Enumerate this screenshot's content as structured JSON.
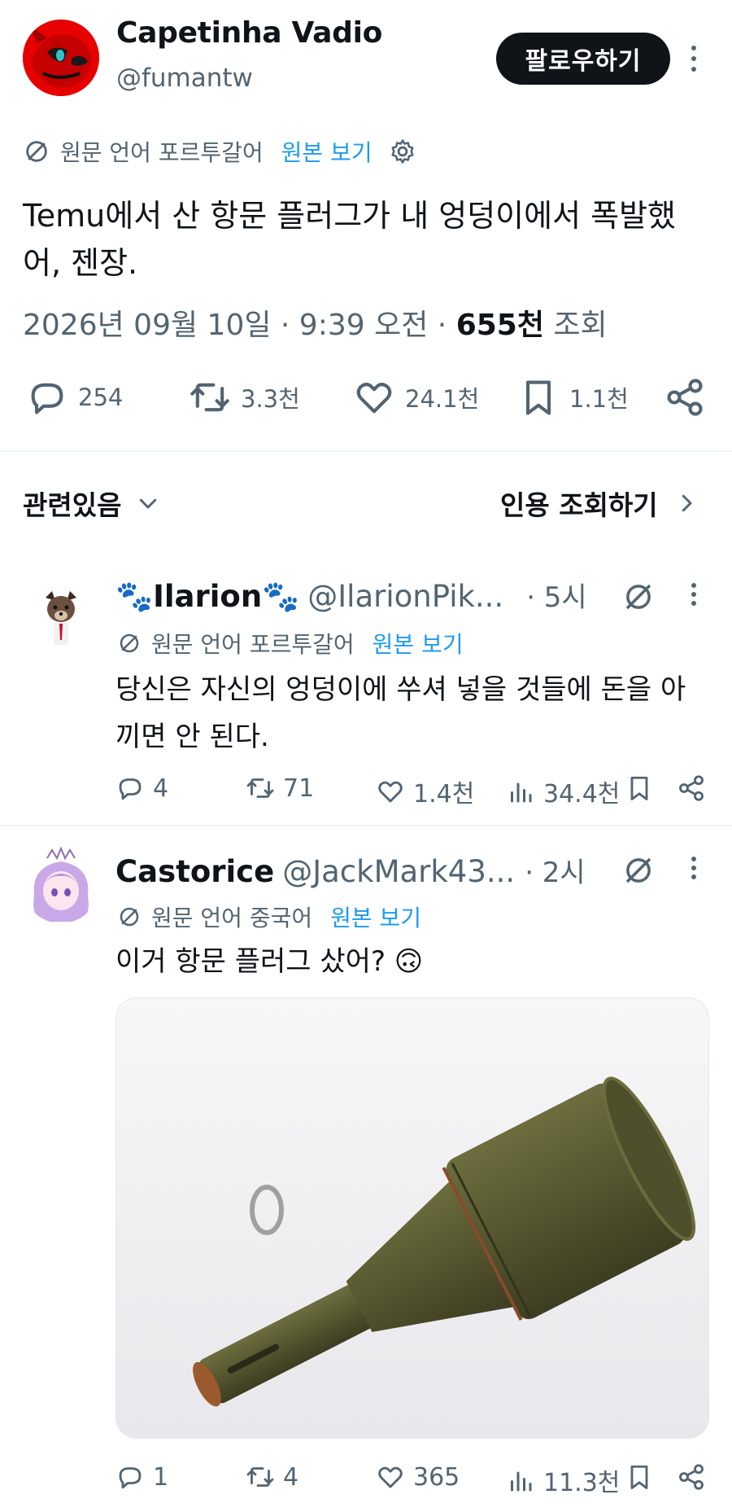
{
  "post": {
    "author_name": "Capetinha Vadio",
    "author_handle": "@fumantw",
    "follow_label": "팔로우하기",
    "translated_from": "원문 언어 포르투갈어",
    "show_original": "원본 보기",
    "text": "Temu에서 산 항문 플러그가 내 엉덩이에서 폭발했어, 젠장.",
    "date": "2026년 09월 10일 · 9:39 오전",
    "views_count": "655천",
    "views_label": "조회",
    "stats": {
      "replies": "254",
      "reposts": "3.3천",
      "likes": "24.1천",
      "bookmarks": "1.1천"
    }
  },
  "related": {
    "label": "관련있음",
    "quote_link": "인용 조회하기"
  },
  "replies": [
    {
      "name": "🐾Ilarion🐾",
      "handle": "@IlarionPik...",
      "time": "· 5시",
      "translated_from": "원문 언어 포르투갈어",
      "show_original": "원본 보기",
      "text": "당신은 자신의 엉덩이에 쑤셔 넣을 것들에 돈을 아끼면 안 된다.",
      "stats": {
        "replies": "4",
        "reposts": "71",
        "likes": "1.4천",
        "views": "34.4천"
      }
    },
    {
      "name": "Castorice",
      "handle": "@JackMark43...",
      "time": "· 2시",
      "translated_from": "원문 언어 중국어",
      "show_original": "원본 보기",
      "text": "이거 항문 플러그 샀어? 🙃",
      "stats": {
        "replies": "1",
        "reposts": "4",
        "likes": "365",
        "views": "11.3천"
      }
    }
  ],
  "colors": {
    "text_primary": "#0f1419",
    "text_secondary": "#536471",
    "link": "#1d9bf0",
    "divider": "#eff3f4",
    "avatar_red": "#e60000"
  },
  "icons": [
    "reply-icon",
    "repost-icon",
    "like-icon",
    "bookmark-icon",
    "share-icon",
    "views-icon",
    "translate-icon",
    "gear-icon",
    "grok-icon",
    "chevron-down-icon",
    "chevron-right-icon",
    "more-icon"
  ]
}
